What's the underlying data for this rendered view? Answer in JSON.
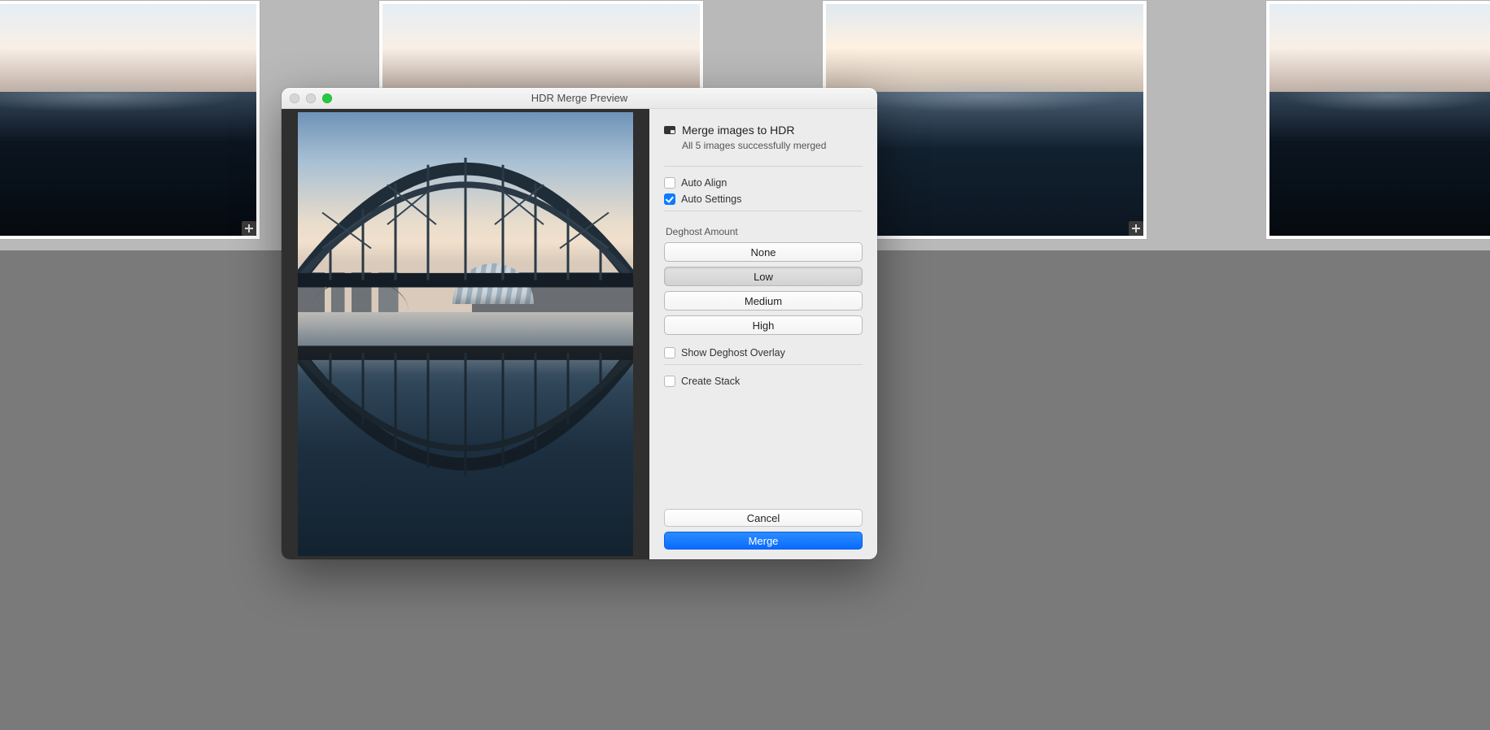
{
  "window": {
    "title": "HDR Merge Preview"
  },
  "header": {
    "title": "Merge images to HDR",
    "subtitle": "All 5 images successfully merged"
  },
  "checkboxes": {
    "auto_align": {
      "label": "Auto Align",
      "checked": false
    },
    "auto_settings": {
      "label": "Auto Settings",
      "checked": true
    },
    "show_deghost": {
      "label": "Show Deghost Overlay",
      "checked": false
    },
    "create_stack": {
      "label": "Create Stack",
      "checked": false
    }
  },
  "deghost": {
    "label": "Deghost Amount",
    "options": [
      "None",
      "Low",
      "Medium",
      "High"
    ],
    "selected": "Low"
  },
  "buttons": {
    "cancel": "Cancel",
    "merge": "Merge"
  }
}
